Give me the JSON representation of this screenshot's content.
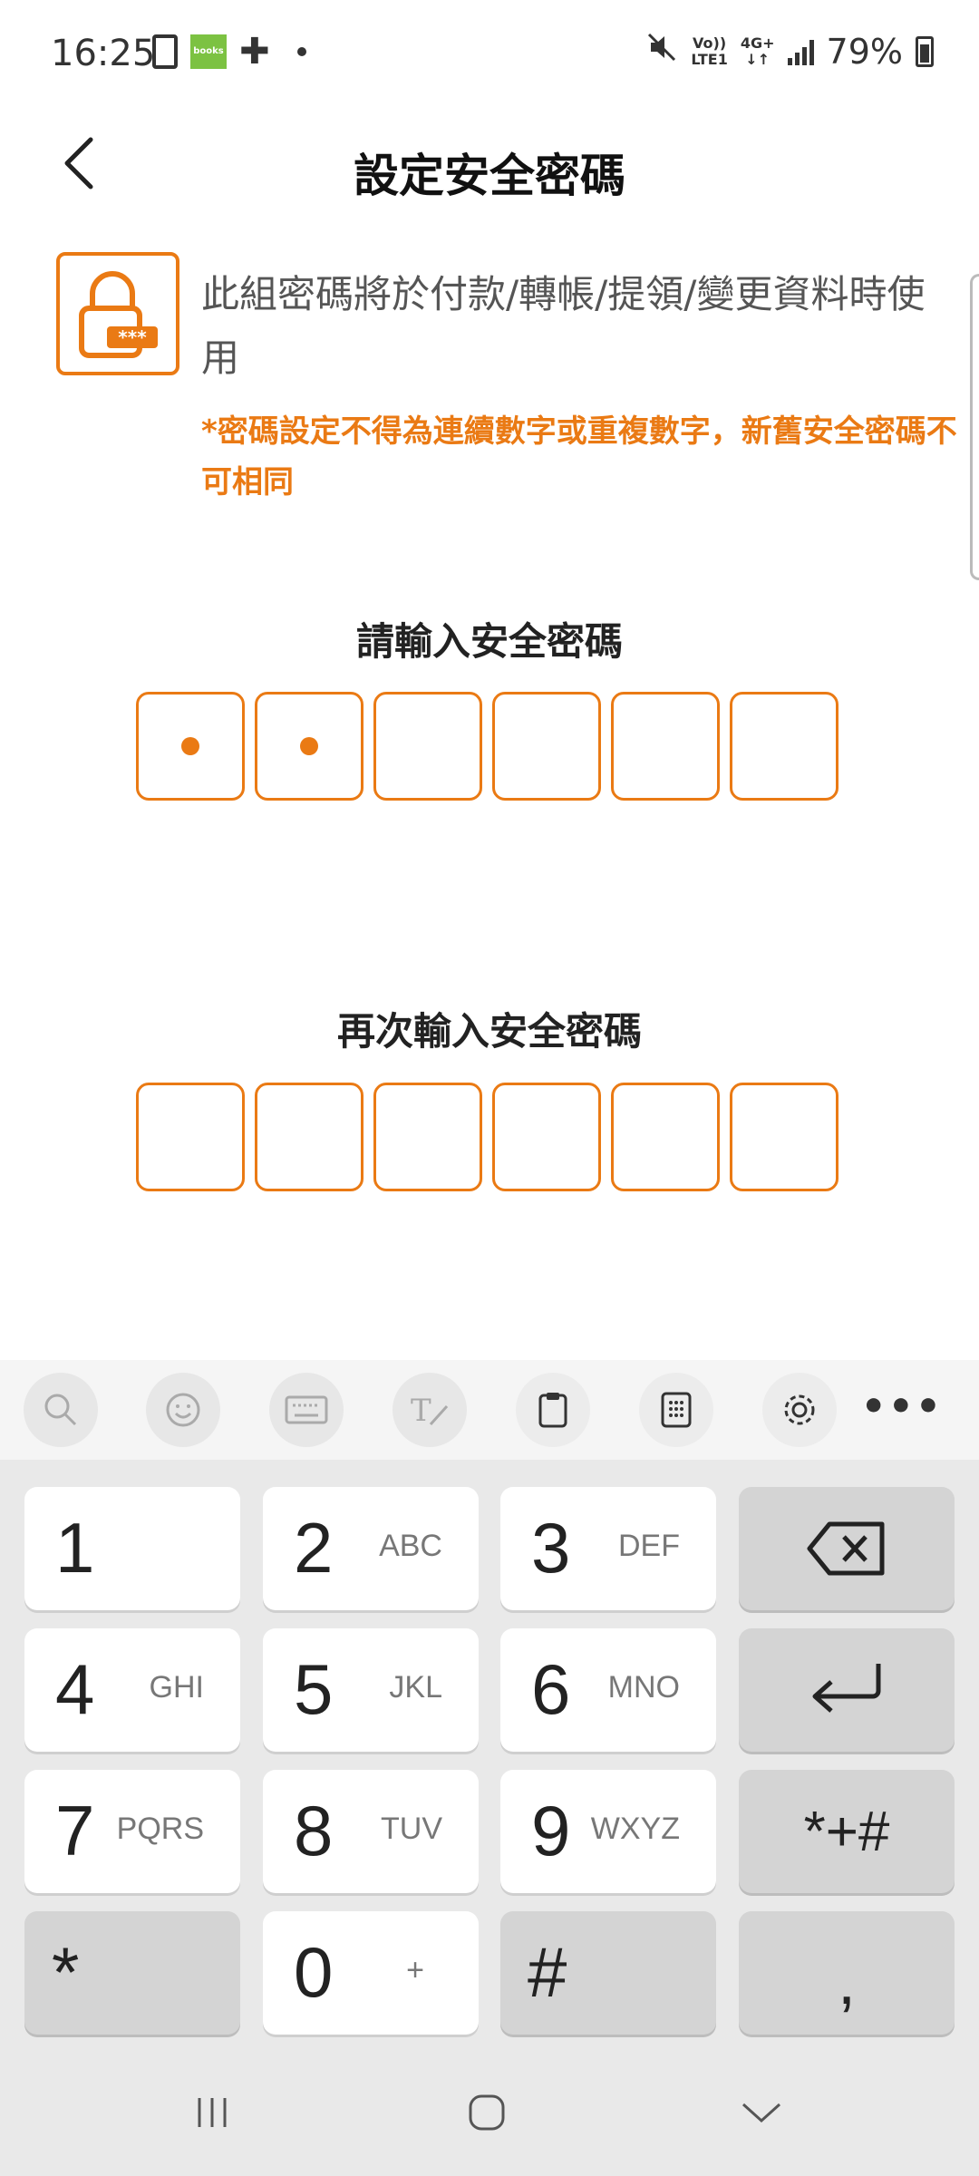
{
  "status_bar": {
    "time": "16:25",
    "battery_percent": "79%",
    "volte_label": "Vo))",
    "lte_label": "LTE1",
    "network_label": "4G+",
    "books_label": "books",
    "icons": [
      "phone-icon",
      "books-app-icon",
      "plus-icon",
      "notification-dot-icon",
      "mute-icon",
      "signal-icon",
      "battery-icon"
    ]
  },
  "header": {
    "title": "設定安全密碼",
    "back_icon": "chevron-left-icon"
  },
  "notice": {
    "icon": "lock-keypad-icon",
    "text": "此組密碼將於付款/轉帳/提領/變更資料時使用",
    "warning": "*密碼設定不得為連續數字或重複數字，新舊安全密碼不可相同"
  },
  "pin_entry": {
    "label": "請輸入安全密碼",
    "length": 6,
    "filled": 2
  },
  "pin_confirm": {
    "label": "再次輸入安全密碼",
    "length": 6,
    "filled": 0
  },
  "keyboard": {
    "toolbar": [
      "search-icon",
      "emoji-icon",
      "keyboard-icon",
      "handwriting-icon",
      "clipboard-icon",
      "numpad-icon",
      "gear-icon",
      "more-icon"
    ],
    "more_label": "•••",
    "keys": [
      {
        "num": "1",
        "letters": ""
      },
      {
        "num": "2",
        "letters": "ABC"
      },
      {
        "num": "3",
        "letters": "DEF"
      },
      {
        "num": "4",
        "letters": "GHI"
      },
      {
        "num": "5",
        "letters": "JKL"
      },
      {
        "num": "6",
        "letters": "MNO"
      },
      {
        "num": "7",
        "letters": "PQRS"
      },
      {
        "num": "8",
        "letters": "TUV"
      },
      {
        "num": "9",
        "letters": "WXYZ"
      },
      {
        "num": "0",
        "letters": "+"
      }
    ],
    "star_label": "*",
    "hash_label": "#",
    "symbols_label": "*+#",
    "comma_label": ",",
    "backspace_icon": "backspace-icon",
    "enter_icon": "enter-icon"
  },
  "colors": {
    "accent": "#ea7a14",
    "keyboard_bg": "#e9e9e9",
    "key_dark": "#d4d4d4"
  },
  "nav_bar": [
    "recent-apps-icon",
    "home-icon",
    "back-chevron-icon"
  ]
}
